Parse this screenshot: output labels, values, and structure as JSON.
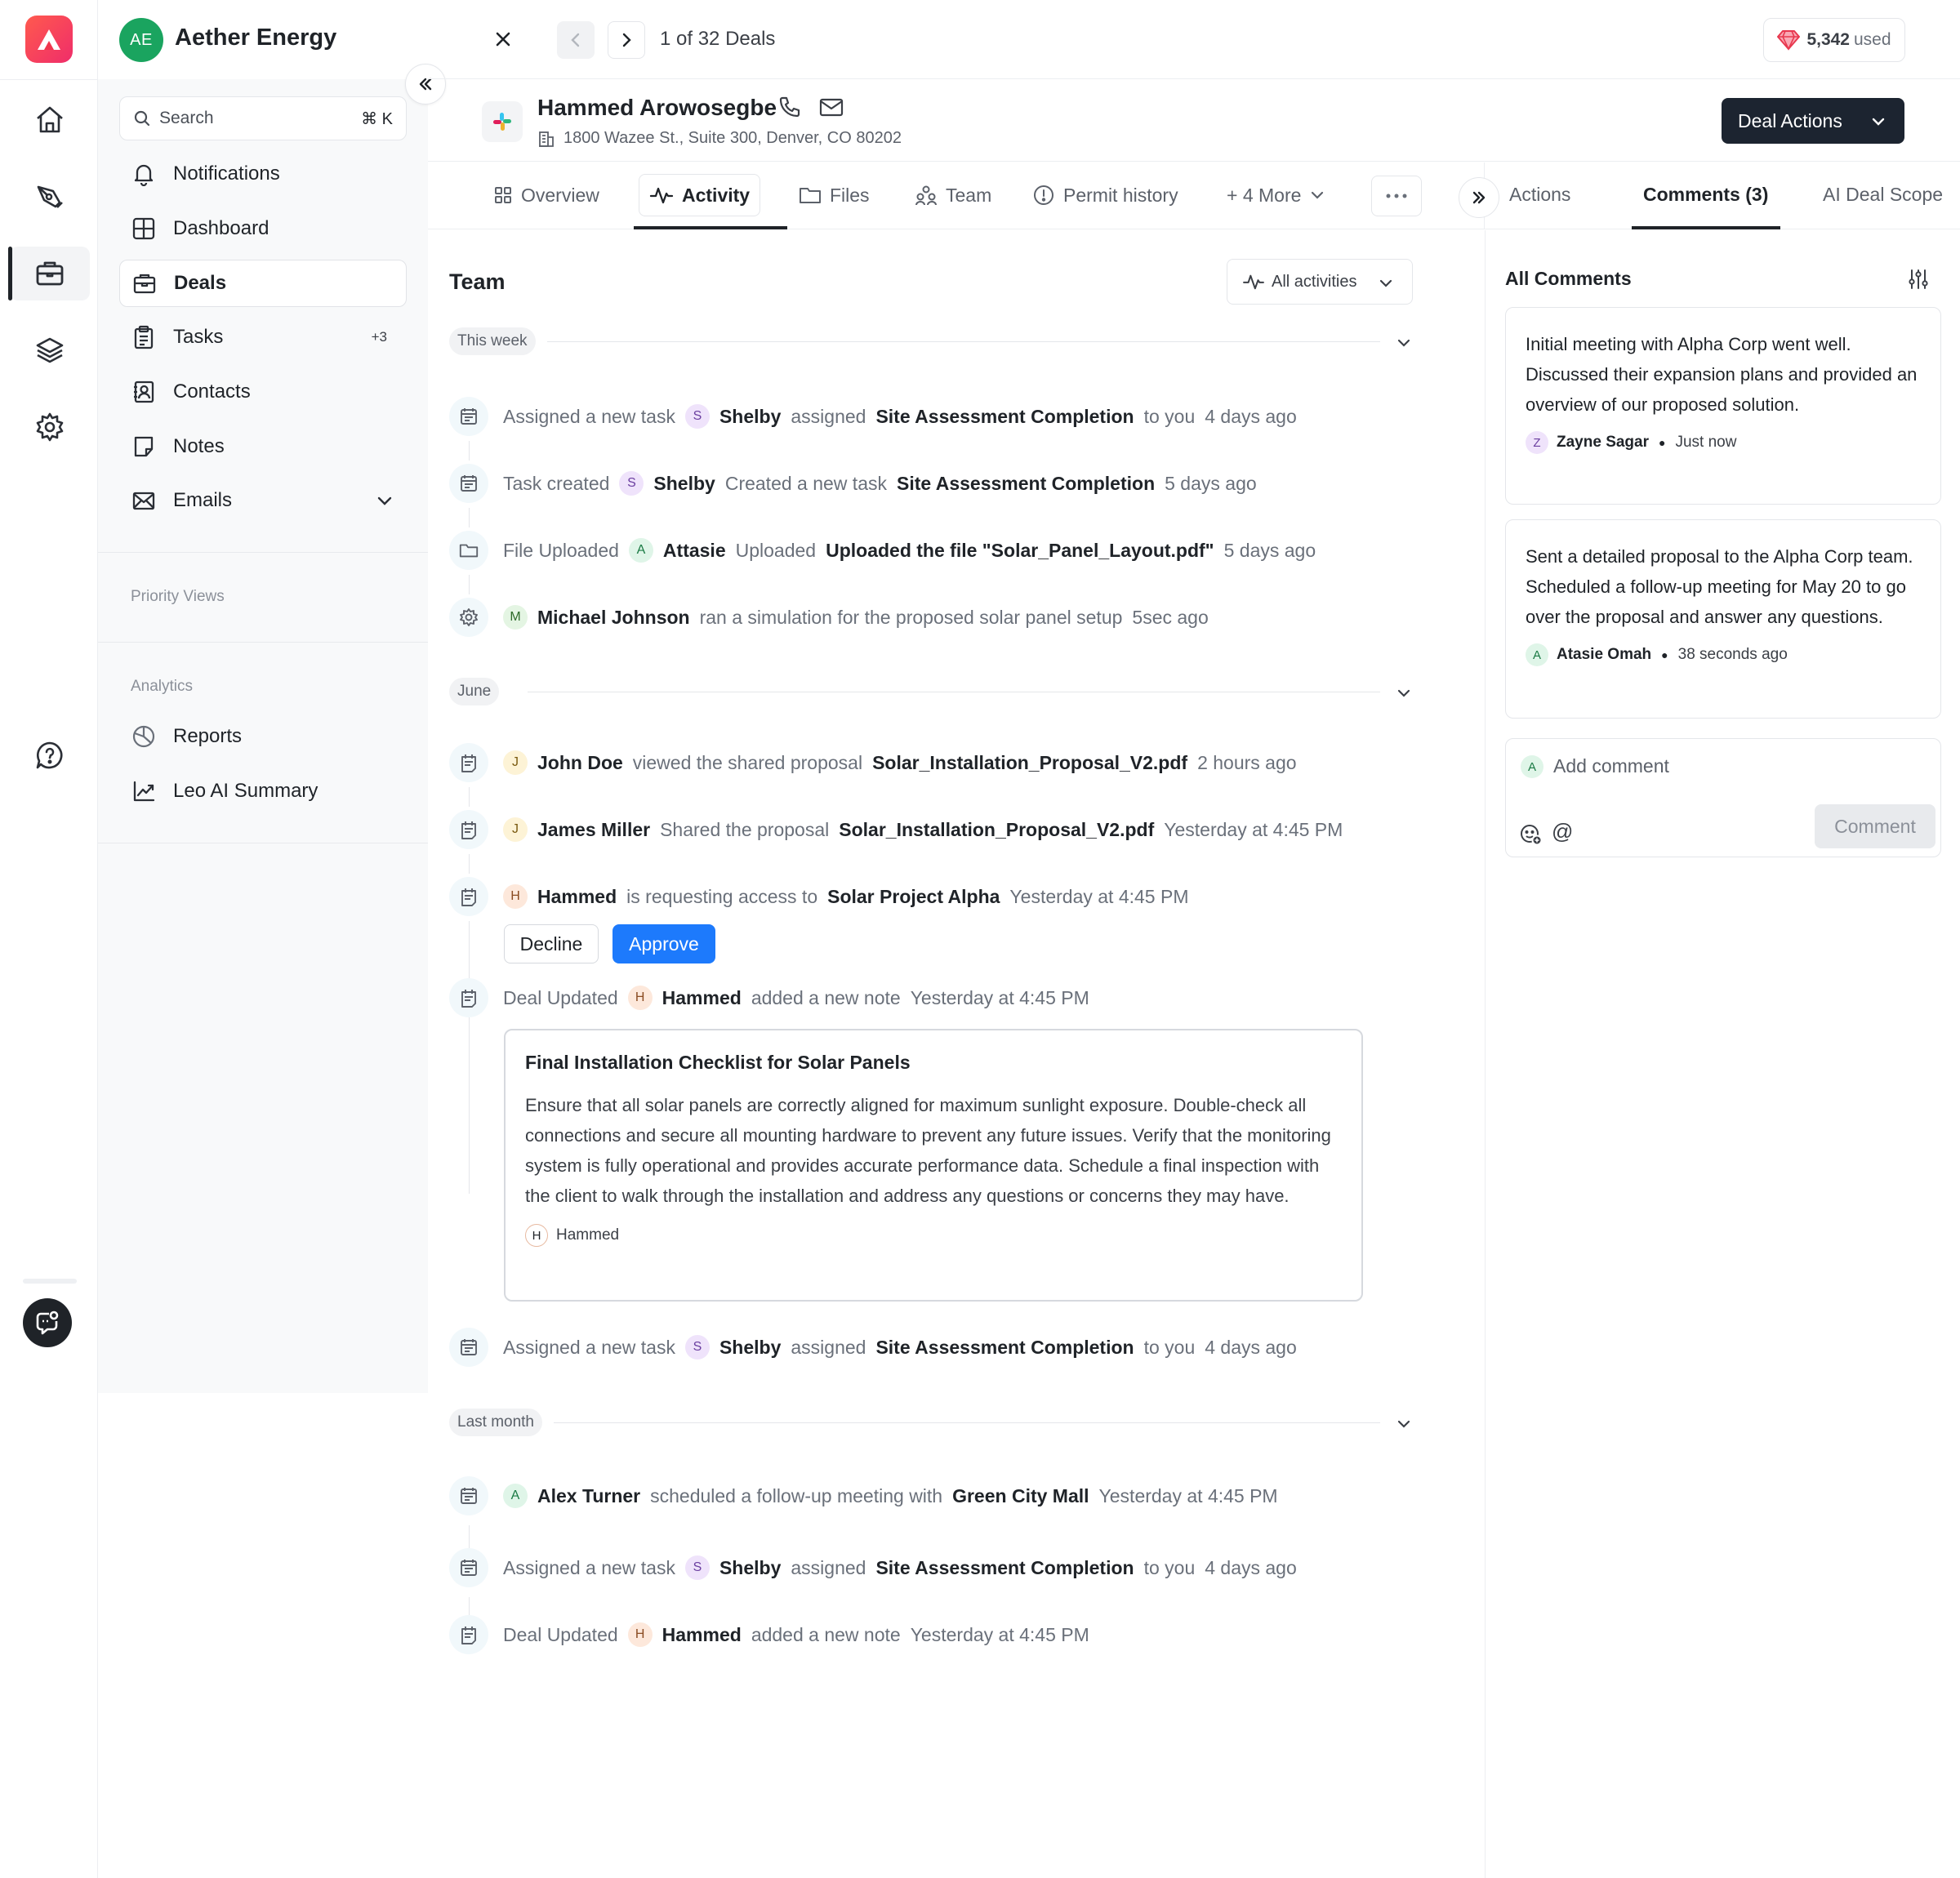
{
  "app": {
    "brand_color": "#f0364e"
  },
  "sidebar": {
    "org_initials": "AE",
    "org_name": "Aether Energy",
    "search_placeholder": "Search",
    "search_shortcut": "⌘ K",
    "items": [
      {
        "label": "Notifications",
        "icon": "bell-icon"
      },
      {
        "label": "Dashboard",
        "icon": "grid-icon"
      },
      {
        "label": "Deals",
        "icon": "briefcase-icon",
        "active": true
      },
      {
        "label": "Tasks",
        "icon": "clipboard-icon",
        "badge": "+3"
      },
      {
        "label": "Contacts",
        "icon": "contact-book-icon"
      },
      {
        "label": "Notes",
        "icon": "note-icon"
      },
      {
        "label": "Emails",
        "icon": "mail-icon"
      }
    ],
    "priority_views_label": "Priority Views",
    "analytics_label": "Analytics",
    "analytics_items": [
      {
        "label": "Reports",
        "icon": "pie-chart-icon"
      },
      {
        "label": "Leo AI Summary",
        "icon": "line-chart-icon"
      }
    ]
  },
  "topbar": {
    "counter": "1 of 32 Deals",
    "credits_value": "5,342",
    "credits_suffix": "used"
  },
  "deal": {
    "name": "Hammed Arowosegbe",
    "address": "1800 Wazee St., Suite 300, Denver, CO 80202",
    "actions_label": "Deal Actions"
  },
  "tabs": {
    "overview": "Overview",
    "activity": "Activity",
    "files": "Files",
    "team": "Team",
    "permit": "Permit history",
    "more": "+ 4 More"
  },
  "right_tabs": {
    "actions": "Actions",
    "comments": "Comments (3)",
    "scope": "AI Deal Scope"
  },
  "feed": {
    "title": "Team",
    "filter_label": "All activities",
    "groups": [
      "This week",
      "June",
      "Last month"
    ],
    "activities": [
      {
        "prefix": "Assigned a new task",
        "initial": "S",
        "actor": "Shelby",
        "verb": "assigned",
        "object": "Site Assessment Completion",
        "suffix": "to you",
        "time": "4 days ago"
      },
      {
        "prefix": "Task created",
        "initial": "S",
        "actor": "Shelby",
        "verb": "Created a new task",
        "object": "Site Assessment Completion",
        "time": "5 days ago"
      },
      {
        "prefix": "File Uploaded",
        "initial": "A",
        "actor": "Attasie",
        "verb": "Uploaded",
        "object": "Uploaded the file \"Solar_Panel_Layout.pdf\"",
        "time": "5 days ago"
      },
      {
        "initial": "M",
        "actor": "Michael Johnson",
        "verb": "ran a simulation for the proposed solar panel setup",
        "time": "5sec ago"
      },
      {
        "initial": "J",
        "actor": "John Doe",
        "verb": "viewed the shared proposal",
        "object": "Solar_Installation_Proposal_V2.pdf",
        "time": "2 hours ago"
      },
      {
        "initial": "J",
        "actor": "James Miller",
        "verb": "Shared the proposal",
        "object": "Solar_Installation_Proposal_V2.pdf",
        "time": "Yesterday at 4:45 PM"
      },
      {
        "initial": "H",
        "actor": "Hammed",
        "verb": "is requesting access to",
        "object": "Solar Project Alpha",
        "time": "Yesterday at 4:45 PM"
      },
      {
        "prefix": "Deal Updated",
        "initial": "H",
        "actor": "Hammed",
        "verb": "added a new note",
        "time": "Yesterday at 4:45 PM"
      },
      {
        "prefix": "Assigned a new task",
        "initial": "S",
        "actor": "Shelby",
        "verb": "assigned",
        "object": "Site Assessment Completion",
        "suffix": "to you",
        "time": "4 days ago"
      },
      {
        "initial": "A",
        "actor": "Alex Turner",
        "verb": "scheduled a follow-up meeting with",
        "object": "Green City Mall",
        "time": "Yesterday at 4:45 PM"
      },
      {
        "prefix": "Assigned a new task",
        "initial": "S",
        "actor": "Shelby",
        "verb": "assigned",
        "object": "Site Assessment Completion",
        "suffix": "to you",
        "time": "4 days ago"
      },
      {
        "prefix": "Deal Updated",
        "initial": "H",
        "actor": "Hammed",
        "verb": "added a new note",
        "time": "Yesterday at 4:45 PM"
      }
    ],
    "decline_label": "Decline",
    "approve_label": "Approve",
    "note": {
      "title": "Final Installation Checklist for Solar Panels",
      "body": "Ensure that all solar panels are correctly aligned for maximum sunlight exposure. Double-check all connections and secure all mounting hardware to prevent any future issues. Verify that the monitoring system is fully operational and provides accurate performance data. Schedule a final inspection with the client to walk through the installation and address any questions or concerns they may have.",
      "author_initial": "H",
      "author": "Hammed"
    }
  },
  "comments": {
    "header": "All Comments",
    "items": [
      {
        "text": "Initial meeting with Alpha Corp went well. Discussed their expansion plans and provided an overview of our proposed solution.",
        "initial": "Z",
        "author": "Zayne Sagar",
        "time": "Just now"
      },
      {
        "text": "Sent a detailed proposal to the Alpha Corp team. Scheduled a follow-up meeting for May 20 to go over the proposal and answer any questions.",
        "initial": "A",
        "author": "Atasie Omah",
        "time": "38 seconds ago"
      }
    ],
    "input_initial": "A",
    "input_placeholder": "Add comment",
    "mention_symbol": "@",
    "submit_label": "Comment"
  }
}
